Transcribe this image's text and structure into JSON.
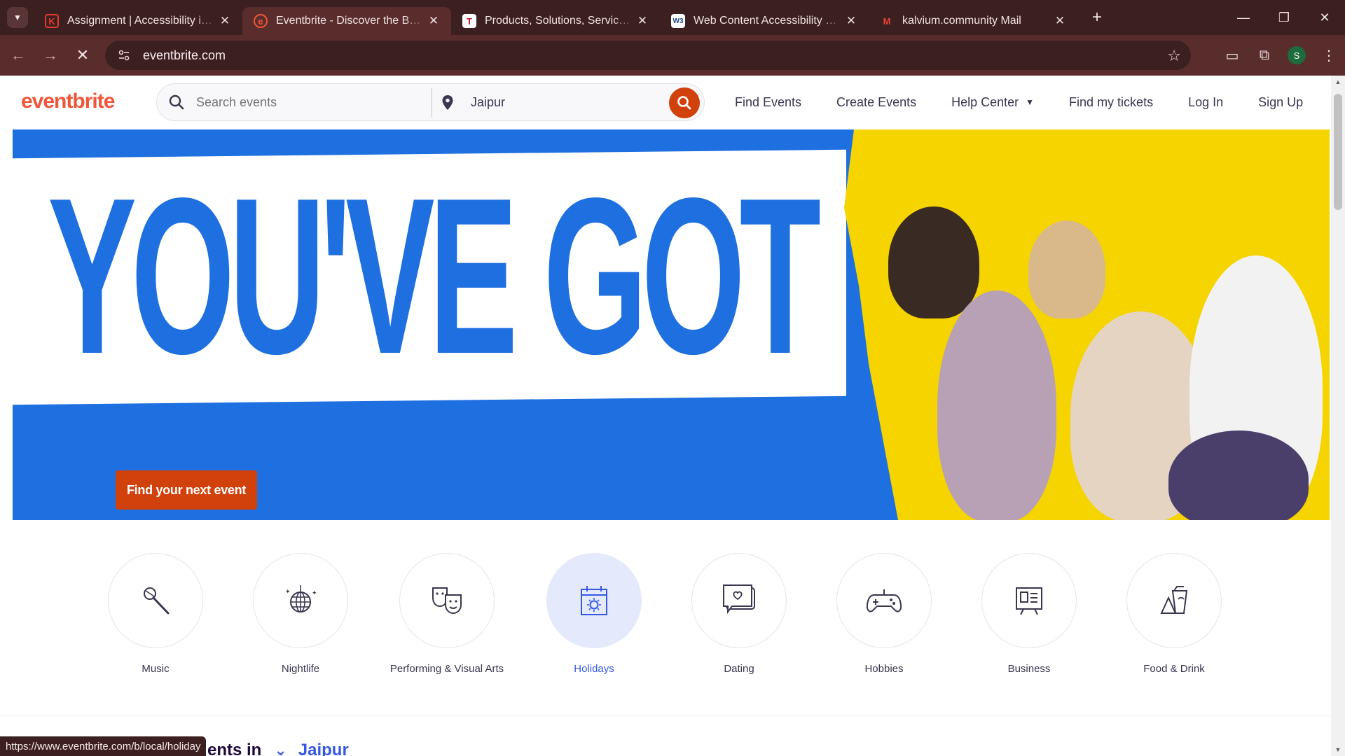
{
  "browser": {
    "tabs": [
      {
        "title": "Assignment | Accessibility in De",
        "favicon": "K",
        "favicon_color": "#e33b2e",
        "active": false
      },
      {
        "title": "Eventbrite - Discover the Best L",
        "favicon": "e",
        "favicon_color": "#f05537",
        "active": true
      },
      {
        "title": "Products, Solutions, Services | T",
        "favicon": "T",
        "favicon_color": "#ffffff",
        "active": false
      },
      {
        "title": "Web Content Accessibility Guid",
        "favicon": "W3",
        "favicon_color": "#1a4b8c",
        "active": false
      },
      {
        "title": "kalvium.community Mail",
        "favicon": "M",
        "favicon_color": "#ea4335",
        "active": false
      }
    ],
    "url": "eventbrite.com",
    "profile_initial": "S",
    "status_url": "https://www.eventbrite.com/b/local/holiday"
  },
  "header": {
    "logo": "eventbrite",
    "search_placeholder": "Search events",
    "location_value": "Jaipur",
    "nav": [
      "Find Events",
      "Create Events",
      "Help Center",
      "Find my tickets",
      "Log In",
      "Sign Up"
    ]
  },
  "hero": {
    "headline": "YOU'VE GOT PLANS",
    "cta": "Find your next event"
  },
  "categories": [
    {
      "label": "Music",
      "icon": "microphone-icon",
      "selected": false
    },
    {
      "label": "Nightlife",
      "icon": "disco-ball-icon",
      "selected": false
    },
    {
      "label": "Performing & Visual Arts",
      "icon": "theater-masks-icon",
      "selected": false
    },
    {
      "label": "Holidays",
      "icon": "calendar-sun-icon",
      "selected": true
    },
    {
      "label": "Dating",
      "icon": "chat-heart-icon",
      "selected": false
    },
    {
      "label": "Hobbies",
      "icon": "gamepad-icon",
      "selected": false
    },
    {
      "label": "Business",
      "icon": "presentation-board-icon",
      "selected": false
    },
    {
      "label": "Food & Drink",
      "icon": "food-drink-icon",
      "selected": false
    }
  ],
  "section": {
    "heading_partial": "ents in",
    "city": "Jaipur"
  },
  "colors": {
    "brand_orange": "#f05537",
    "cta_orange": "#d1410c",
    "hero_blue": "#1e6fe0",
    "hero_yellow": "#f5d400",
    "selected_blue": "#3659e3"
  }
}
